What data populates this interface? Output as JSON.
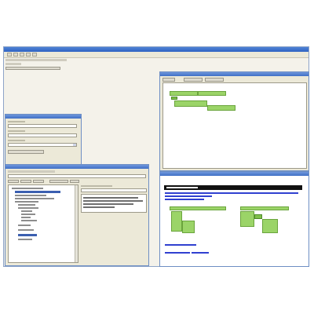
{
  "app": {
    "title": "",
    "menu": [
      "",
      "",
      "",
      "",
      ""
    ],
    "toolbar_rows": [
      "",
      "",
      ""
    ]
  },
  "properties_panel": {
    "title": "",
    "fields": [
      "",
      "",
      "",
      ""
    ],
    "button_label": ""
  },
  "tree_panel": {
    "title": "",
    "toolbar": [
      "",
      "",
      "",
      ""
    ],
    "tree_items": [
      "",
      "",
      "",
      "",
      "",
      "",
      "",
      "",
      "",
      "",
      "",
      "",
      "",
      ""
    ],
    "detail_fields": [
      "",
      ""
    ]
  },
  "diagram_panel": {
    "title": "",
    "tabs": [
      "",
      "",
      ""
    ],
    "nodes": [
      "",
      "",
      ""
    ]
  },
  "preview_panel": {
    "title": "",
    "heading_bar": "",
    "links": [
      "",
      "",
      ""
    ]
  },
  "colors": {
    "title_bar": "#3f6fc6",
    "panel_bg": "#ece9d8",
    "node_green": "#9bd468",
    "link_blue": "#3040d0"
  }
}
